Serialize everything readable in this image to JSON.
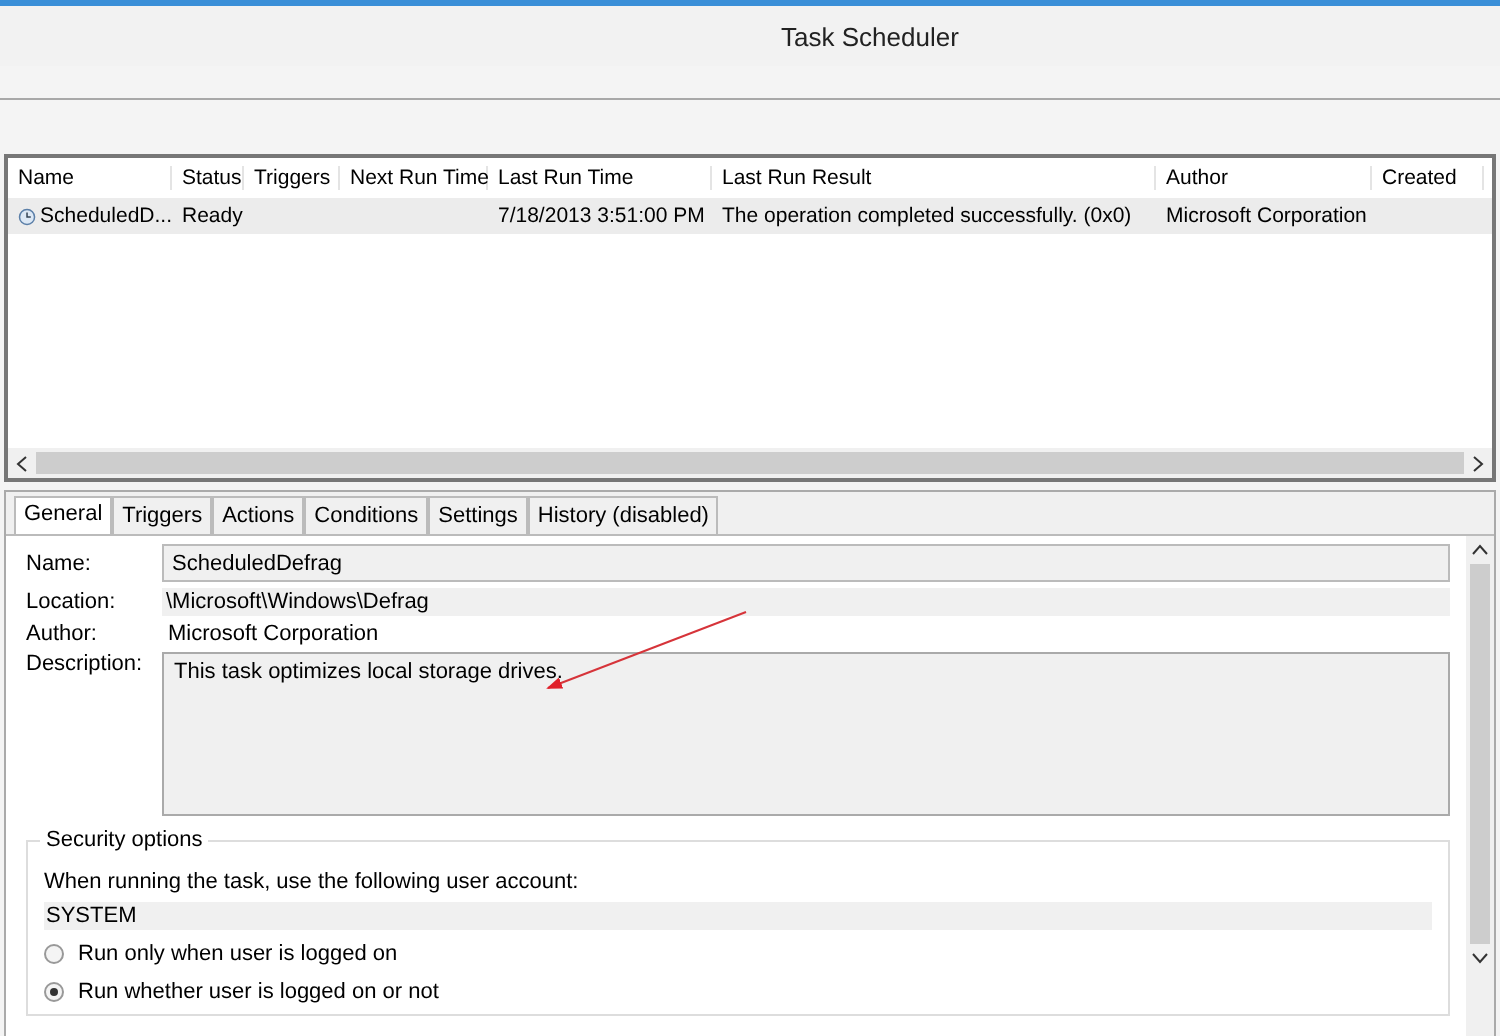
{
  "window": {
    "title": "Task Scheduler"
  },
  "table": {
    "columns": [
      "Name",
      "Status",
      "Triggers",
      "Next Run Time",
      "Last Run Time",
      "Last Run Result",
      "Author",
      "Created"
    ],
    "rows": [
      {
        "selected": true,
        "cells": [
          "ScheduledD...",
          "Ready",
          "",
          "",
          "7/18/2013 3:51:00 PM",
          "The operation completed successfully. (0x0)",
          "Microsoft Corporation",
          ""
        ]
      }
    ]
  },
  "tabs": [
    {
      "label": "General",
      "selected": true
    },
    {
      "label": "Triggers",
      "selected": false
    },
    {
      "label": "Actions",
      "selected": false
    },
    {
      "label": "Conditions",
      "selected": false
    },
    {
      "label": "Settings",
      "selected": false
    },
    {
      "label": "History (disabled)",
      "selected": false
    }
  ],
  "general": {
    "name_label": "Name:",
    "name_value": "ScheduledDefrag",
    "location_label": "Location:",
    "location_value": "\\Microsoft\\Windows\\Defrag",
    "author_label": "Author:",
    "author_value": "Microsoft Corporation",
    "description_label": "Description:",
    "description_value": "This task optimizes local storage drives."
  },
  "security": {
    "title": "Security options",
    "account_prompt": "When running the task, use the following user account:",
    "account": "SYSTEM",
    "options": [
      {
        "label": "Run only when user is logged on",
        "selected": false
      },
      {
        "label": "Run whether user is logged on or not",
        "selected": true
      }
    ]
  }
}
